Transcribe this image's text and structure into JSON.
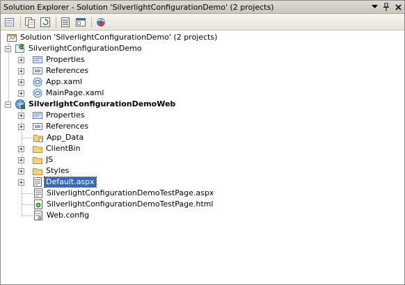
{
  "window": {
    "title": "Solution Explorer - Solution 'SilverlightConfigurationDemo' (2 projects)",
    "buttons": [
      "dropdown-icon",
      "pin-icon",
      "close-icon"
    ]
  },
  "toolbar": {
    "icons": [
      "properties-icon",
      "show-all-files-icon",
      "refresh-icon",
      "view-code-icon",
      "view-designer-icon",
      "silverlight-icon"
    ]
  },
  "tree": {
    "solution": "Solution 'SilverlightConfigurationDemo' (2 projects)",
    "project1": {
      "name": "SilverlightConfigurationDemo",
      "items": [
        "Properties",
        "References",
        "App.xaml",
        "MainPage.xaml"
      ]
    },
    "project2": {
      "name": "SilverlightConfigurationDemoWeb",
      "items": [
        "Properties",
        "References",
        "App_Data",
        "ClientBin",
        "JS",
        "Styles",
        "Default.aspx",
        "SilverlightConfigurationDemoTestPage.aspx",
        "SilverlightConfigurationDemoTestPage.html",
        "Web.config"
      ],
      "selected": "Default.aspx"
    }
  }
}
